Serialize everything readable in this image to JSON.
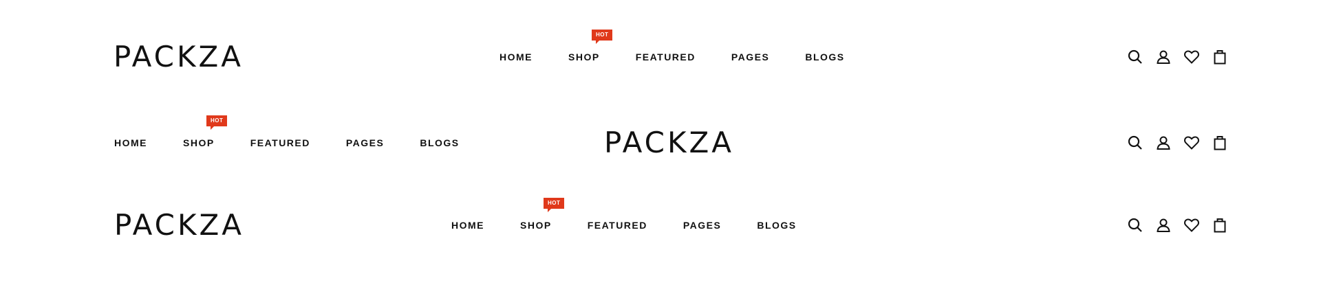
{
  "brand": "PACKZA",
  "badge": "HOT",
  "nav": [
    "HOME",
    "SHOP",
    "FEATURED",
    "PAGES",
    "BLOGS"
  ],
  "badge_color": "#e0391b",
  "icons": [
    "search-icon",
    "user-icon",
    "heart-icon",
    "shopping-bag-icon"
  ]
}
